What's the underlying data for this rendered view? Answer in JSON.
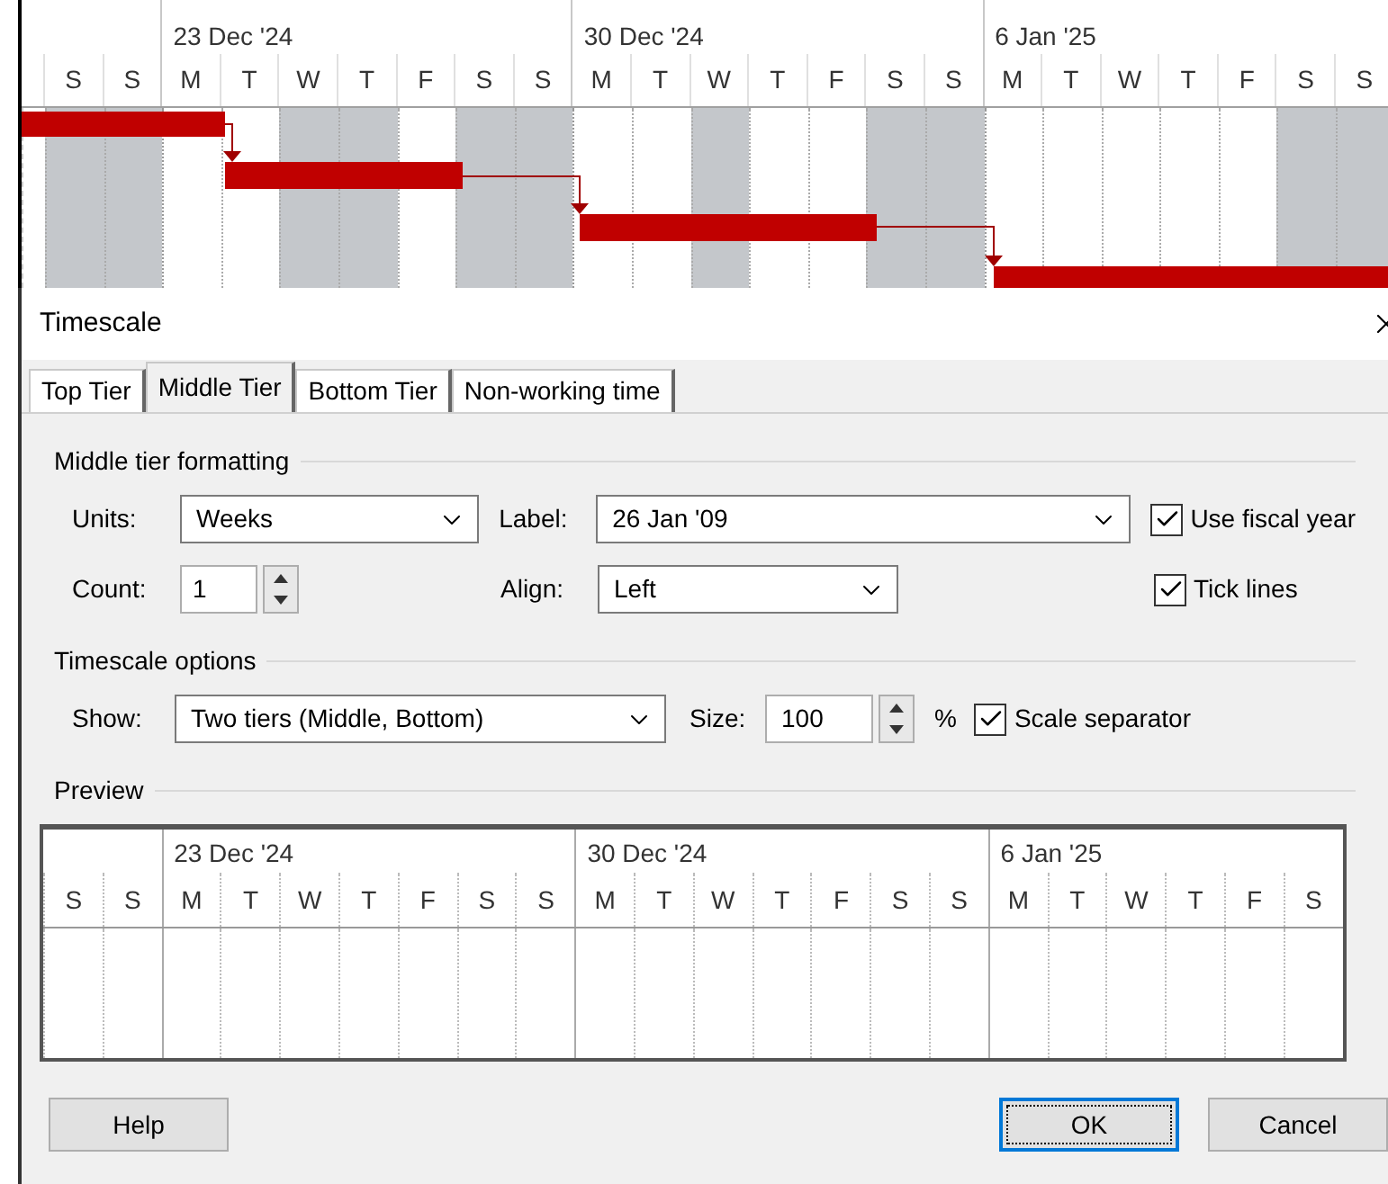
{
  "gantt": {
    "days_before": [
      {
        "label": "S",
        "nonworking": true
      },
      {
        "label": "S",
        "nonworking": true
      }
    ],
    "weeks": [
      {
        "label": "23 Dec '24",
        "days": [
          {
            "label": "M",
            "nonworking": false
          },
          {
            "label": "T",
            "nonworking": false
          },
          {
            "label": "W",
            "nonworking": true
          },
          {
            "label": "T",
            "nonworking": true
          },
          {
            "label": "F",
            "nonworking": false
          },
          {
            "label": "S",
            "nonworking": true
          },
          {
            "label": "S",
            "nonworking": true
          }
        ]
      },
      {
        "label": "30 Dec '24",
        "days": [
          {
            "label": "M",
            "nonworking": false
          },
          {
            "label": "T",
            "nonworking": false
          },
          {
            "label": "W",
            "nonworking": true
          },
          {
            "label": "T",
            "nonworking": false
          },
          {
            "label": "F",
            "nonworking": false
          },
          {
            "label": "S",
            "nonworking": true
          },
          {
            "label": "S",
            "nonworking": true
          }
        ]
      },
      {
        "label": "6 Jan '25",
        "days": [
          {
            "label": "M",
            "nonworking": false
          },
          {
            "label": "T",
            "nonworking": false
          },
          {
            "label": "W",
            "nonworking": false
          },
          {
            "label": "T",
            "nonworking": false
          },
          {
            "label": "F",
            "nonworking": false
          },
          {
            "label": "S",
            "nonworking": true
          },
          {
            "label": "S",
            "nonworking": true
          }
        ]
      }
    ]
  },
  "dialog": {
    "title": "Timescale",
    "tabs": [
      {
        "label": "Top Tier",
        "selected": false
      },
      {
        "label": "Middle Tier",
        "selected": true
      },
      {
        "label": "Bottom Tier",
        "selected": false
      },
      {
        "label": "Non-working time",
        "selected": false
      }
    ],
    "middle_tier_formatting": {
      "title": "Middle tier formatting",
      "units": {
        "label": "Units:",
        "value": "Weeks"
      },
      "label": {
        "label": "Label:",
        "value": "26 Jan '09"
      },
      "use_fiscal_year": {
        "label": "Use fiscal year",
        "checked": true
      },
      "count": {
        "label": "Count:",
        "value": "1"
      },
      "align": {
        "label": "Align:",
        "value": "Left"
      },
      "tick_lines": {
        "label": "Tick lines",
        "checked": true
      }
    },
    "timescale_options": {
      "title": "Timescale options",
      "show": {
        "label": "Show:",
        "value": "Two tiers (Middle, Bottom)"
      },
      "size": {
        "label": "Size:",
        "value": "100",
        "unit": "%"
      },
      "scale_separator": {
        "label": "Scale separator",
        "checked": true
      }
    },
    "preview": {
      "title": "Preview",
      "days_before": [
        "S",
        "S"
      ],
      "weeks": [
        {
          "label": "23 Dec '24",
          "days": [
            "M",
            "T",
            "W",
            "T",
            "F",
            "S",
            "S"
          ]
        },
        {
          "label": "30 Dec '24",
          "days": [
            "M",
            "T",
            "W",
            "T",
            "F",
            "S",
            "S"
          ]
        },
        {
          "label": "6 Jan '25",
          "days": [
            "M",
            "T",
            "W",
            "T",
            "F",
            "S"
          ]
        }
      ]
    },
    "buttons": [
      {
        "label": "Help",
        "default": false
      },
      {
        "label": "OK",
        "default": true
      },
      {
        "label": "Cancel",
        "default": false
      }
    ]
  }
}
